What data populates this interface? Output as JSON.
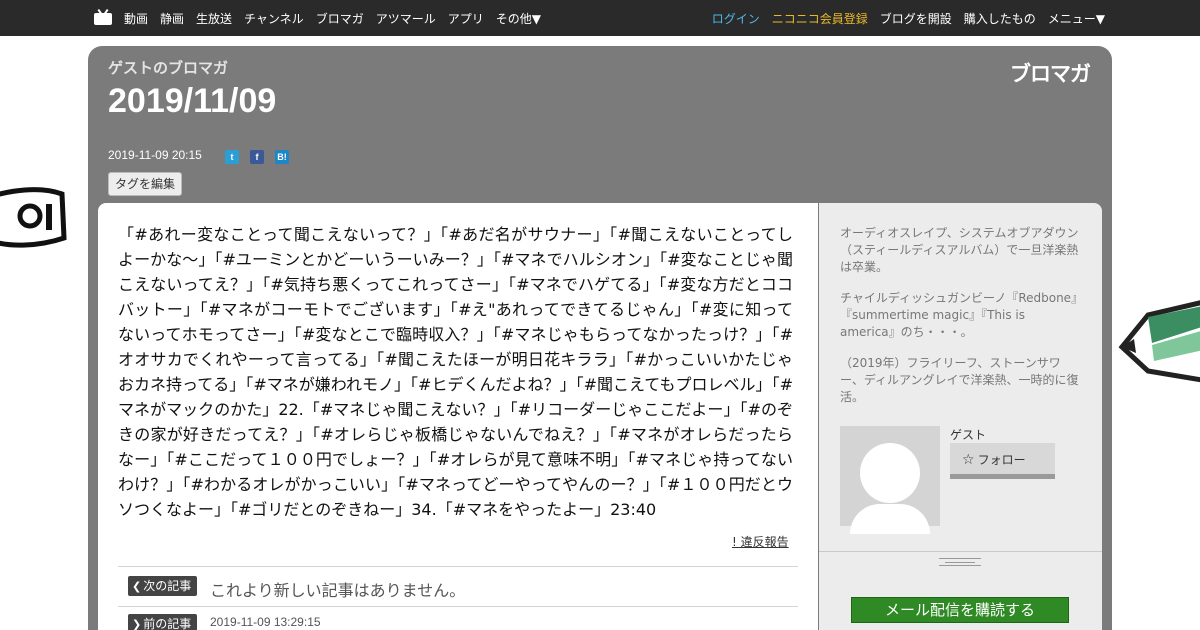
{
  "nav": {
    "left": [
      "動画",
      "静画",
      "生放送",
      "チャンネル",
      "ブロマガ",
      "アツマール",
      "アプリ",
      "その他▼"
    ],
    "right": {
      "login": "ログイン",
      "premium": "ニコニコ会員登録",
      "open_blog": "ブログを開設",
      "purchased": "購入したもの",
      "menu": "メニュー▼"
    }
  },
  "blog": {
    "owner": "ゲストのブロマガ",
    "title": "2019/11/09",
    "logo": "ブロマガ",
    "post_date": "2019-11-09 20:15",
    "tag_edit": "タグを編集",
    "share": {
      "twitter_icon": "twitter-icon",
      "facebook_icon": "facebook-icon",
      "hatena_label": "B!"
    }
  },
  "article": {
    "text": "「#あれー変なことって聞こえないって？」「#あだ名がサウナー」「#聞こえないことってしよーかな〜」「#ユーミンとかどーいうーいみー？」「#マネでハルシオン」「#変なことじゃ聞こえないってえ？」「#気持ち悪くってこれってさー」「#マネでハゲてる」「#変な方だとココバットー」「#マネがコーモトでございます」「#え\"あれってできてるじゃん」「#変に知ってないってホモってさー」「#変なとこで臨時収入？」「#マネじゃもらってなかったっけ？」「#オオサカでくれやーって言ってる」「#聞こえたほーが明日花キララ」「#かっこいいかたじゃおカネ持ってる」「#マネが嫌われモノ」「#ヒデくんだよね？」「#聞こえてもプロレベル」「#マネがマックのかた」22.「#マネじゃ聞こえない？」「#リコーダーじゃここだよー」「#のぞきの家が好きだってえ？」「#オレらじゃ板橋じゃないんでねえ？」「#マネがオレらだったらなー」「#ここだって１００円でしょー？」「#オレらが見て意味不明」「#マネじゃ持ってないわけ？」「#わかるオレがかっこいい」「#マネってどーやってやんのー？」「#１００円だとウソつくなよー」「#ゴリだとのぞきねー」34.「#マネをやったよー」23:40",
    "report": "! 違反報告",
    "next_label": "次の記事",
    "next_msg": "これより新しい記事はありません。",
    "prev_label": "前の記事",
    "prev_date": "2019-11-09 13:29:15"
  },
  "sidebar": {
    "p1": "オーディオスレイプ、システムオブアダウン（スティールディスアルバム）で一旦洋楽熱は卒業。",
    "p2": "チャイルディッシュガンビーノ『Redbone』『summertime magic』『This is america』のち・・・。",
    "p3": "（2019年）フライリーフ、ストーンサワー、ディルアングレイで洋楽熱、一時的に復活。",
    "guest_name": "ゲスト",
    "follow": "フォロー",
    "subscribe": "メール配信を購読する"
  },
  "colors": {
    "topbar": "#2a2a2a",
    "blog_header": "#7b7b7b",
    "login_link": "#4fb9e8",
    "premium_link": "#e8b82a",
    "subscribe_button": "#2f8a26"
  }
}
